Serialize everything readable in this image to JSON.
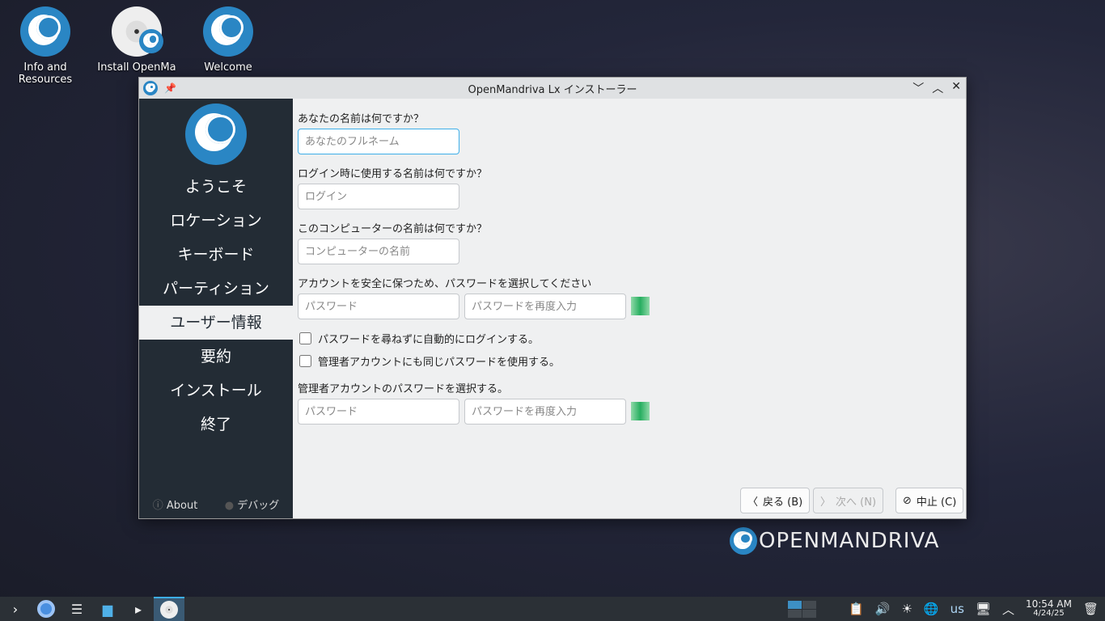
{
  "desktop": {
    "icons": [
      {
        "label": "Info and Resources"
      },
      {
        "label": "Install OpenMa"
      },
      {
        "label": "Welcome"
      }
    ],
    "brand": "OPENMANDRIVA"
  },
  "window": {
    "title": "OpenMandriva Lx インストーラー"
  },
  "sidebar": {
    "items": [
      "ようこそ",
      "ロケーション",
      "キーボード",
      "パーティション",
      "ユーザー情報",
      "要約",
      "インストール",
      "終了"
    ],
    "active": 4,
    "about": "About",
    "debug": "デバッグ"
  },
  "form": {
    "name_label": "あなたの名前は何ですか？",
    "name_placeholder": "あなたのフルネーム",
    "login_label": "ログイン時に使用する名前は何ですか？",
    "login_placeholder": "ログイン",
    "host_label": "このコンピューターの名前は何ですか？",
    "host_placeholder": "コンピューターの名前",
    "pw_label": "アカウントを安全に保つため、パスワードを選択してください",
    "pw_placeholder": "パスワード",
    "pw2_placeholder": "パスワードを再度入力",
    "autologin": "パスワードを尋ねずに自動的にログインする。",
    "same_admin": "管理者アカウントにも同じパスワードを使用する。",
    "admin_label": "管理者アカウントのパスワードを選択する。",
    "admin_pw_placeholder": "パスワード",
    "admin_pw2_placeholder": "パスワードを再度入力"
  },
  "buttons": {
    "back": "戻る (B)",
    "next": "次へ (N)",
    "cancel": "中止 (C)"
  },
  "taskbar": {
    "keyboard_layout": "us",
    "time": "10:54 AM",
    "date": "4/24/25"
  }
}
